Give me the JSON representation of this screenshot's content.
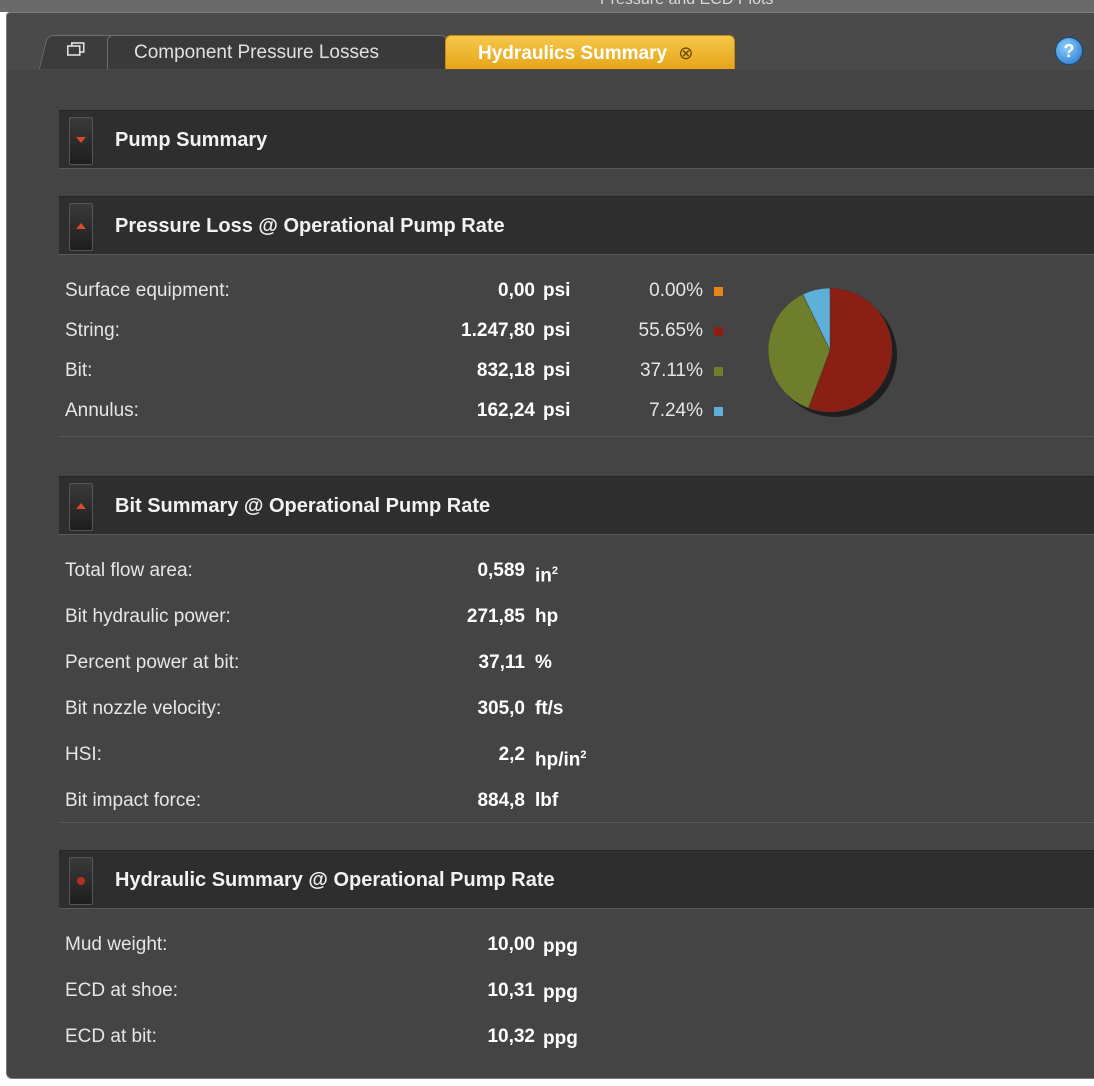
{
  "window": {
    "title": "Pressure and ECD Plots"
  },
  "tabs": {
    "component_pressure_losses": "Component Pressure Losses",
    "hydraulics_summary": "Hydraulics Summary",
    "close_symbol": "⊗",
    "help": "?"
  },
  "sections": {
    "pump_summary": "Pump Summary",
    "pressure_loss": "Pressure Loss @ Operational Pump Rate",
    "bit_summary": "Bit Summary @ Operational Pump Rate",
    "hydraulic_summary": "Hydraulic Summary @ Operational Pump Rate"
  },
  "pressure_loss": [
    {
      "label": "Surface equipment:",
      "value": "0,00",
      "unit": "psi",
      "percent": "0.00%",
      "color": "#e8851a"
    },
    {
      "label": "String:",
      "value": "1.247,80",
      "unit": "psi",
      "percent": "55.65%",
      "color": "#8b1f14"
    },
    {
      "label": "Bit:",
      "value": "832,18",
      "unit": "psi",
      "percent": "37.11%",
      "color": "#6e7e2a"
    },
    {
      "label": "Annulus:",
      "value": "162,24",
      "unit": "psi",
      "percent": "7.24%",
      "color": "#5fb0d8"
    }
  ],
  "chart_data": {
    "type": "pie",
    "categories": [
      "Surface equipment",
      "String",
      "Bit",
      "Annulus"
    ],
    "values": [
      0.0,
      55.65,
      37.11,
      7.24
    ],
    "colors": [
      "#e8851a",
      "#8b1f14",
      "#6e7e2a",
      "#5fb0d8"
    ],
    "title": ""
  },
  "bit_summary": [
    {
      "label": "Total flow area:",
      "value": "0,589",
      "unit": "in",
      "sup": "2"
    },
    {
      "label": "Bit hydraulic power:",
      "value": "271,85",
      "unit": "hp",
      "sup": ""
    },
    {
      "label": "Percent power at bit:",
      "value": "37,11",
      "unit": "%",
      "sup": ""
    },
    {
      "label": "Bit nozzle velocity:",
      "value": "305,0",
      "unit": "ft/s",
      "sup": ""
    },
    {
      "label": "HSI:",
      "value": "2,2",
      "unit": "hp/in",
      "sup": "2"
    },
    {
      "label": "Bit impact force:",
      "value": "884,8",
      "unit": "lbf",
      "sup": ""
    }
  ],
  "hydraulic_summary": [
    {
      "label": "Mud weight:",
      "value": "10,00",
      "unit": "ppg"
    },
    {
      "label": "ECD at shoe:",
      "value": "10,31",
      "unit": "ppg"
    },
    {
      "label": "ECD at bit:",
      "value": "10,32",
      "unit": "ppg"
    }
  ]
}
